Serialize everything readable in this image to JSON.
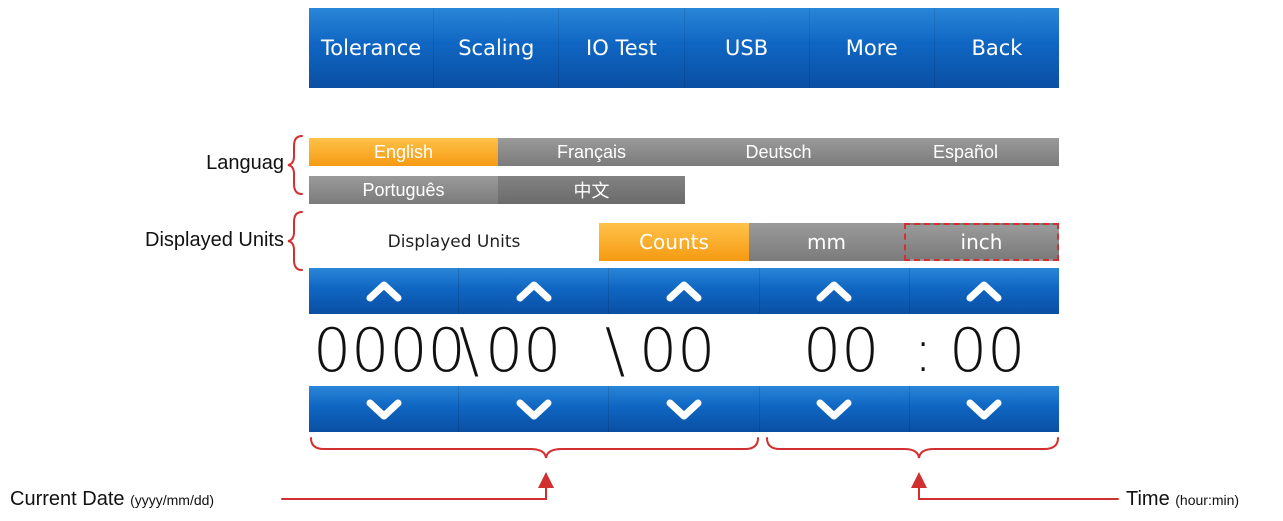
{
  "topbar": [
    "Tolerance",
    "Scaling",
    "IO Test",
    "USB",
    "More",
    "Back"
  ],
  "languages": {
    "selected": "English",
    "items": [
      "English",
      "Français",
      "Deutsch",
      "Español",
      "Português",
      "中文"
    ]
  },
  "units": {
    "label": "Displayed Units",
    "options": [
      "Counts",
      "mm",
      "inch"
    ],
    "selected": "Counts"
  },
  "datetime": {
    "year": "0000",
    "sep1": "\\",
    "month": "00",
    "sep2": "\\",
    "day": "00",
    "hour": "00",
    "colon": ":",
    "minute": "00"
  },
  "annotations": {
    "language": "Languag",
    "units": "Displayed Units",
    "date_main": "Current Date",
    "date_sub": "(yyyy/mm/dd)",
    "time_main": "Time",
    "time_sub": "(hour:min)"
  },
  "colors": {
    "blue": "#0f66c2",
    "orange": "#f59a12",
    "gray": "#8a8a8a",
    "annotation": "#d23030"
  }
}
